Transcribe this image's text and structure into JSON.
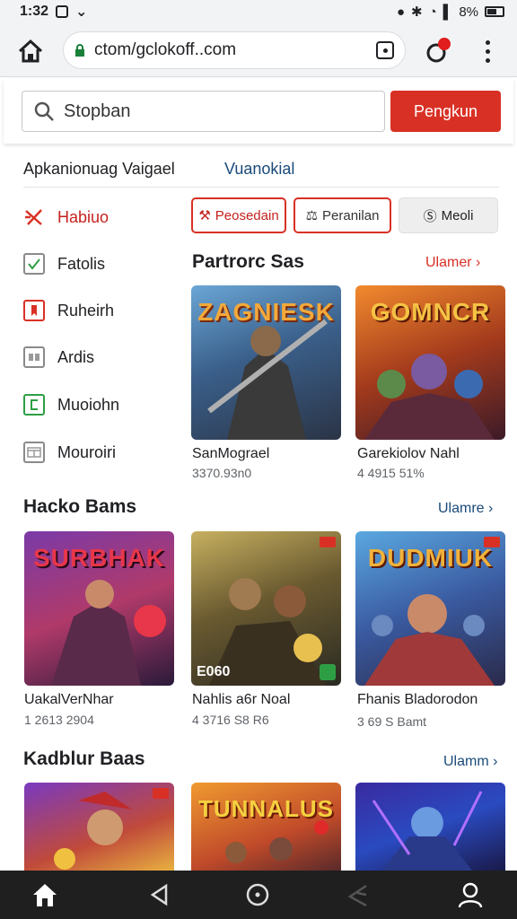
{
  "status_bar": {
    "time": "1:32",
    "battery": "8%"
  },
  "browser": {
    "url": "ctom/gclokoff..com"
  },
  "search": {
    "placeholder": "Stopban",
    "button_label": "Pengkun"
  },
  "tabs": [
    {
      "label": "Apkanionuag Vaigael"
    },
    {
      "label": "Vuanokial"
    }
  ],
  "sidebar": {
    "items": [
      {
        "label": "Habiuo",
        "icon": "sword-icon"
      },
      {
        "label": "Fatolis",
        "icon": "check-box-icon"
      },
      {
        "label": "Ruheirh",
        "icon": "bookmark-icon"
      },
      {
        "label": "Ardis",
        "icon": "grid-box-icon"
      },
      {
        "label": "Muoiohn",
        "icon": "tag-icon"
      },
      {
        "label": "Mouroiri",
        "icon": "window-icon"
      }
    ]
  },
  "filters": [
    {
      "label": "Peosedain",
      "icon": "hammer-icon"
    },
    {
      "label": "Peranilan",
      "icon": "tools-icon"
    },
    {
      "label": "Meoli",
      "icon": "s-icon"
    }
  ],
  "sections": [
    {
      "title": "Partrorc Sas",
      "more": "Ulamer",
      "cards": [
        {
          "art_text": "ZAGNIESK",
          "title": "SanMograel",
          "subtitle": "3370.93n0"
        },
        {
          "art_text": "GOMNCR",
          "title": "Garekiolov Nahl",
          "subtitle": "4 4915 51%"
        }
      ]
    },
    {
      "title": "Hacko Bams",
      "more": "Ulamre",
      "cards": [
        {
          "art_text": "SURBHAK",
          "title": "UakalVerNhar",
          "subtitle": "1 2613 2904"
        },
        {
          "art_text": "E060",
          "title": "Nahlis a6r Noal",
          "subtitle": "4 3716 S8 R6"
        },
        {
          "art_text": "DUDMIUK",
          "title": "Fhanis Bladorodon",
          "subtitle": "3 69 S Bamt"
        }
      ]
    },
    {
      "title": "Kadblur Baas",
      "more": "Ulamm",
      "cards": [
        {
          "art_text": ""
        },
        {
          "art_text": "TUNNALUS"
        },
        {
          "art_text": ""
        }
      ]
    }
  ],
  "colors": {
    "accent": "#d93025",
    "link": "#1a4a7a"
  }
}
